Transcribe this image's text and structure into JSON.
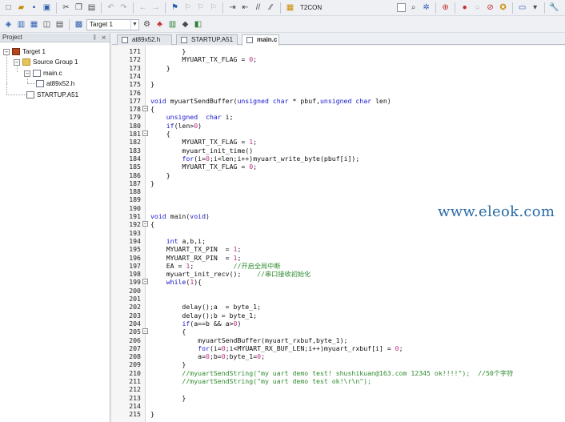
{
  "toolbar_top": {
    "target_label": "T2CON",
    "icons": [
      "new-file-icon",
      "open-folder-icon",
      "save-icon",
      "save-all-icon",
      "cut-icon",
      "copy-icon",
      "paste-icon",
      "undo-icon",
      "redo-icon",
      "back-icon",
      "forward-icon",
      "bookmark-icon",
      "bookmark-prev-icon",
      "bookmark-next-icon",
      "bookmark-clear-icon",
      "indent-icon",
      "unindent-icon",
      "comment-icon",
      "uncomment-icon",
      "find-in-files-icon",
      "combo-checkbox-icon",
      "find-icon",
      "wizard-icon",
      "debug-icon",
      "breakpoint-icon",
      "breakpoint-disable-icon",
      "breakpoint-kill-icon",
      "breakpoint-all-icon",
      "window-icon",
      "settings-icon"
    ]
  },
  "toolbar_build": {
    "target_combo": "Target 1",
    "icons": [
      "translate-icon",
      "build-icon",
      "rebuild-icon",
      "batch-build-icon",
      "download-icon",
      "options-icon",
      "manage-icon",
      "books-icon",
      "event-icon",
      "component-icon"
    ]
  },
  "project_panel": {
    "title": "Project",
    "pin_close": "ᛒ ✕",
    "tree": [
      {
        "label": "Target 1"
      },
      {
        "label": "Source Group 1"
      },
      {
        "label": "main.c"
      },
      {
        "label": "at89x52.h"
      },
      {
        "label": "STARTUP.A51"
      }
    ]
  },
  "editor_tabs": [
    {
      "label": "at89x52.h"
    },
    {
      "label": "STARTUP.A51"
    },
    {
      "label": "main.c"
    }
  ],
  "colors": {
    "keyword": "#1a1acc",
    "comment": "#2e8b2e",
    "number": "#c22b8c",
    "string": "#7b007b",
    "text": "#111111"
  },
  "code_lines": [
    {
      "num": "171",
      "fold": "",
      "segs": [
        {
          "t": "        }",
          "c": "text"
        }
      ]
    },
    {
      "num": "172",
      "fold": "",
      "segs": [
        {
          "t": "        MYUART_TX_FLAG = ",
          "c": "text"
        },
        {
          "t": "0",
          "c": "number"
        },
        {
          "t": ";",
          "c": "text"
        }
      ]
    },
    {
      "num": "173",
      "fold": "",
      "segs": [
        {
          "t": "    }",
          "c": "text"
        }
      ]
    },
    {
      "num": "174",
      "fold": "",
      "segs": [
        {
          "t": "",
          "c": "text"
        }
      ]
    },
    {
      "num": "175",
      "fold": "",
      "segs": [
        {
          "t": "}",
          "c": "text"
        }
      ]
    },
    {
      "num": "176",
      "fold": "",
      "segs": [
        {
          "t": "",
          "c": "text"
        }
      ]
    },
    {
      "num": "177",
      "fold": "",
      "segs": [
        {
          "t": "void",
          "c": "keyword"
        },
        {
          "t": " myuartSendBuffer(",
          "c": "text"
        },
        {
          "t": "unsigned char",
          "c": "keyword"
        },
        {
          "t": " * pbuf,",
          "c": "text"
        },
        {
          "t": "unsigned char",
          "c": "keyword"
        },
        {
          "t": " len)",
          "c": "text"
        }
      ]
    },
    {
      "num": "178",
      "fold": "−",
      "segs": [
        {
          "t": "{",
          "c": "text"
        }
      ]
    },
    {
      "num": "179",
      "fold": "",
      "segs": [
        {
          "t": "    ",
          "c": "text"
        },
        {
          "t": "unsigned  char",
          "c": "keyword"
        },
        {
          "t": " i;",
          "c": "text"
        }
      ]
    },
    {
      "num": "180",
      "fold": "",
      "segs": [
        {
          "t": "    ",
          "c": "text"
        },
        {
          "t": "if",
          "c": "keyword"
        },
        {
          "t": "(len>",
          "c": "text"
        },
        {
          "t": "0",
          "c": "number"
        },
        {
          "t": ")",
          "c": "text"
        }
      ]
    },
    {
      "num": "181",
      "fold": "−",
      "segs": [
        {
          "t": "    {",
          "c": "text"
        }
      ]
    },
    {
      "num": "182",
      "fold": "",
      "segs": [
        {
          "t": "        MYUART_TX_FLAG = ",
          "c": "text"
        },
        {
          "t": "1",
          "c": "number"
        },
        {
          "t": ";",
          "c": "text"
        }
      ]
    },
    {
      "num": "183",
      "fold": "",
      "segs": [
        {
          "t": "        myuart_init_time()",
          "c": "text"
        }
      ]
    },
    {
      "num": "184",
      "fold": "",
      "segs": [
        {
          "t": "        ",
          "c": "text"
        },
        {
          "t": "for",
          "c": "keyword"
        },
        {
          "t": "(i=",
          "c": "text"
        },
        {
          "t": "0",
          "c": "number"
        },
        {
          "t": ";i<len;i++)myuart_write_byte(pbuf[i]);",
          "c": "text"
        }
      ]
    },
    {
      "num": "185",
      "fold": "",
      "segs": [
        {
          "t": "        MYUART_TX_FLAG = ",
          "c": "text"
        },
        {
          "t": "0",
          "c": "number"
        },
        {
          "t": ";",
          "c": "text"
        }
      ]
    },
    {
      "num": "186",
      "fold": "",
      "segs": [
        {
          "t": "    }",
          "c": "text"
        }
      ]
    },
    {
      "num": "187",
      "fold": "",
      "segs": [
        {
          "t": "}",
          "c": "text"
        }
      ]
    },
    {
      "num": "188",
      "fold": "",
      "segs": [
        {
          "t": "",
          "c": "text"
        }
      ]
    },
    {
      "num": "189",
      "fold": "",
      "segs": [
        {
          "t": "",
          "c": "text"
        }
      ]
    },
    {
      "num": "190",
      "fold": "",
      "segs": [
        {
          "t": "",
          "c": "text"
        }
      ]
    },
    {
      "num": "191",
      "fold": "",
      "segs": [
        {
          "t": "void",
          "c": "keyword"
        },
        {
          "t": " main(",
          "c": "text"
        },
        {
          "t": "void",
          "c": "keyword"
        },
        {
          "t": ")",
          "c": "text"
        }
      ]
    },
    {
      "num": "192",
      "fold": "−",
      "segs": [
        {
          "t": "{",
          "c": "text"
        }
      ]
    },
    {
      "num": "193",
      "fold": "",
      "segs": [
        {
          "t": "",
          "c": "text"
        }
      ]
    },
    {
      "num": "194",
      "fold": "",
      "segs": [
        {
          "t": "    ",
          "c": "text"
        },
        {
          "t": "int",
          "c": "keyword"
        },
        {
          "t": " a,b,i;",
          "c": "text"
        }
      ]
    },
    {
      "num": "195",
      "fold": "",
      "segs": [
        {
          "t": "    MYUART_TX_PIN  = ",
          "c": "text"
        },
        {
          "t": "1",
          "c": "number"
        },
        {
          "t": ";",
          "c": "text"
        }
      ]
    },
    {
      "num": "196",
      "fold": "",
      "segs": [
        {
          "t": "    MYUART_RX_PIN  = ",
          "c": "text"
        },
        {
          "t": "1",
          "c": "number"
        },
        {
          "t": ";",
          "c": "text"
        }
      ]
    },
    {
      "num": "197",
      "fold": "",
      "segs": [
        {
          "t": "    EA = ",
          "c": "text"
        },
        {
          "t": "1",
          "c": "number"
        },
        {
          "t": ";",
          "c": "text"
        },
        {
          "t": "          //开启全局中断",
          "c": "comment"
        }
      ]
    },
    {
      "num": "198",
      "fold": "",
      "segs": [
        {
          "t": "    myuart_init_recv();",
          "c": "text"
        },
        {
          "t": "    //串口接收初始化",
          "c": "comment"
        }
      ]
    },
    {
      "num": "199",
      "fold": "−",
      "segs": [
        {
          "t": "    ",
          "c": "text"
        },
        {
          "t": "while",
          "c": "keyword"
        },
        {
          "t": "(",
          "c": "text"
        },
        {
          "t": "1",
          "c": "number"
        },
        {
          "t": "){",
          "c": "text"
        }
      ]
    },
    {
      "num": "200",
      "fold": "",
      "segs": [
        {
          "t": "",
          "c": "text"
        }
      ]
    },
    {
      "num": "201",
      "fold": "",
      "segs": [
        {
          "t": "",
          "c": "text"
        }
      ]
    },
    {
      "num": "202",
      "fold": "",
      "segs": [
        {
          "t": "        delay();a  = byte_1;",
          "c": "text"
        }
      ]
    },
    {
      "num": "203",
      "fold": "",
      "segs": [
        {
          "t": "        delay();b = byte_1;",
          "c": "text"
        }
      ]
    },
    {
      "num": "204",
      "fold": "",
      "segs": [
        {
          "t": "        ",
          "c": "text"
        },
        {
          "t": "if",
          "c": "keyword"
        },
        {
          "t": "(a==b && a>",
          "c": "text"
        },
        {
          "t": "0",
          "c": "number"
        },
        {
          "t": ")",
          "c": "text"
        }
      ]
    },
    {
      "num": "205",
      "fold": "−",
      "segs": [
        {
          "t": "        {",
          "c": "text"
        }
      ]
    },
    {
      "num": "206",
      "fold": "",
      "segs": [
        {
          "t": "            myuartSendBuffer(myuart_rxbuf,byte_1);",
          "c": "text"
        }
      ]
    },
    {
      "num": "207",
      "fold": "",
      "segs": [
        {
          "t": "            ",
          "c": "text"
        },
        {
          "t": "for",
          "c": "keyword"
        },
        {
          "t": "(i=",
          "c": "text"
        },
        {
          "t": "0",
          "c": "number"
        },
        {
          "t": ";i<MYUART_RX_BUF_LEN;i++)myuart_rxbuf[i] = ",
          "c": "text"
        },
        {
          "t": "0",
          "c": "number"
        },
        {
          "t": ";",
          "c": "text"
        }
      ]
    },
    {
      "num": "208",
      "fold": "",
      "segs": [
        {
          "t": "            a=",
          "c": "text"
        },
        {
          "t": "0",
          "c": "number"
        },
        {
          "t": ";b=",
          "c": "text"
        },
        {
          "t": "0",
          "c": "number"
        },
        {
          "t": ";byte_1=",
          "c": "text"
        },
        {
          "t": "0",
          "c": "number"
        },
        {
          "t": ";",
          "c": "text"
        }
      ]
    },
    {
      "num": "209",
      "fold": "",
      "segs": [
        {
          "t": "        }",
          "c": "text"
        }
      ]
    },
    {
      "num": "210",
      "fold": "",
      "segs": [
        {
          "t": "        //myuartSendString(\"my uart demo test! shushikuan@163.com 12345 ok!!!!\");  //50个字符",
          "c": "comment"
        }
      ]
    },
    {
      "num": "211",
      "fold": "",
      "segs": [
        {
          "t": "        //myuartSendString(\"my uart demo test ok!\\r\\n\");",
          "c": "comment"
        }
      ]
    },
    {
      "num": "212",
      "fold": "",
      "segs": [
        {
          "t": "",
          "c": "text"
        }
      ]
    },
    {
      "num": "213",
      "fold": "",
      "segs": [
        {
          "t": "        }",
          "c": "text"
        }
      ]
    },
    {
      "num": "214",
      "fold": "",
      "segs": [
        {
          "t": "",
          "c": "text"
        }
      ]
    },
    {
      "num": "215",
      "fold": "",
      "segs": [
        {
          "t": "}",
          "c": "text"
        }
      ]
    }
  ],
  "watermark": "www.eleok.com"
}
